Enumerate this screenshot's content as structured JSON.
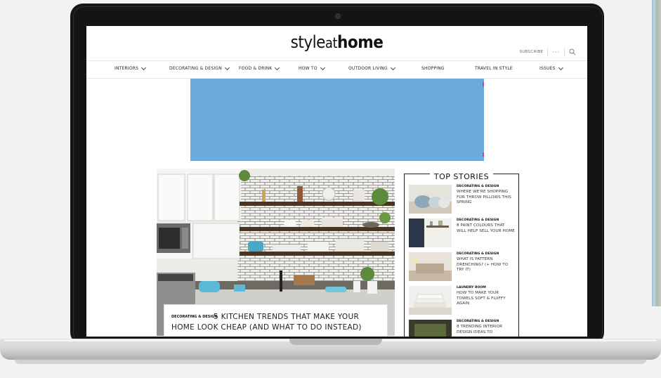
{
  "site": {
    "logo_light": "style",
    "logo_thin": "at",
    "logo_bold": "home",
    "subscribe": "SUBSCRIBE",
    "more": "···"
  },
  "nav": [
    {
      "label": "INTERIORS",
      "has_dropdown": true
    },
    {
      "label": "DECORATING & DESIGN",
      "has_dropdown": true
    },
    {
      "label": "FOOD & DRINK",
      "has_dropdown": true
    },
    {
      "label": "HOW TO",
      "has_dropdown": true
    },
    {
      "label": "OUTDOOR LIVING",
      "has_dropdown": true
    },
    {
      "label": "SHOPPING",
      "has_dropdown": false
    },
    {
      "label": "TRAVEL IN STYLE",
      "has_dropdown": false
    },
    {
      "label": "ISSUES",
      "has_dropdown": true
    }
  ],
  "ad_color": "#6aaadc",
  "feature": {
    "category": "DECORATING & DESIGN",
    "title": "5 KITCHEN TRENDS THAT MAKE YOUR HOME LOOK CHEAP (AND WHAT TO DO INSTEAD)"
  },
  "top_stories": {
    "heading": "TOP STORIES",
    "items": [
      {
        "category": "DECORATING & DESIGN",
        "title": "WHERE WE'RE SHOPPING FOR THROW PILLOWS THIS SPRING",
        "thumb": "pillows"
      },
      {
        "category": "DECORATING & DESIGN",
        "title": "8 PAINT COLOURS THAT WILL HELP SELL YOUR HOME",
        "thumb": "navy-wall"
      },
      {
        "category": "DECORATING & DESIGN",
        "title": "WHAT IS PATTERN DRENCHING? (+ HOW TO TRY IT)",
        "thumb": "bedroom"
      },
      {
        "category": "LAUNDRY ROOM",
        "title": "HOW TO MAKE YOUR TOWELS SOFT & FLUFFY AGAIN",
        "thumb": "towels"
      },
      {
        "category": "DECORATING & DESIGN",
        "title": "8 TRENDING INTERIOR DESIGN IDEAS TO",
        "thumb": "green-room"
      }
    ]
  }
}
